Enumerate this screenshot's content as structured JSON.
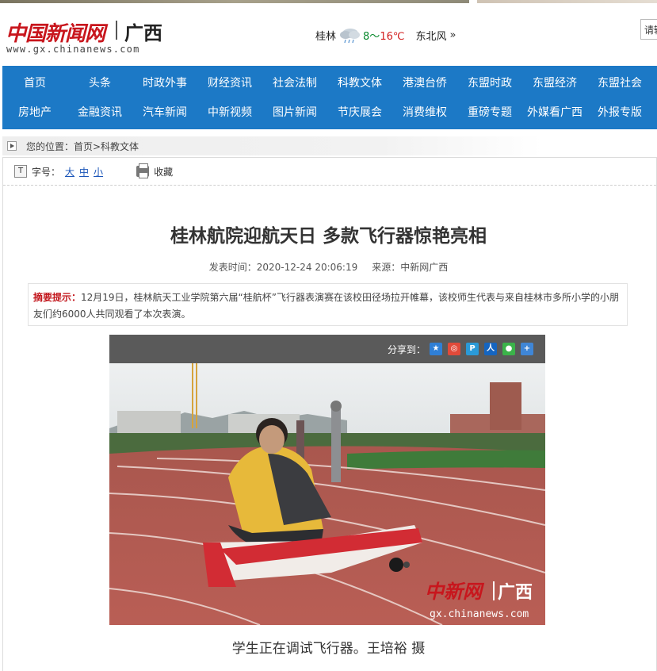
{
  "site": {
    "logo_cn": "中国新闻网",
    "region": "广西",
    "url": "www.gx.chinanews.com"
  },
  "weather": {
    "city": "桂林",
    "icon": "rain-cloud-icon",
    "temp_low": "8",
    "temp_sep": "～",
    "temp_high": "16℃",
    "wind": "东北风",
    "more": "»"
  },
  "search": {
    "label": "请输"
  },
  "nav": {
    "row1": [
      "首页",
      "头条",
      "时政外事",
      "财经资讯",
      "社会法制",
      "科教文体",
      "港澳台侨",
      "东盟时政",
      "东盟经济",
      "东盟社会"
    ],
    "row2": [
      "房地产",
      "金融资讯",
      "汽车新闻",
      "中新视频",
      "图片新闻",
      "节庆展会",
      "消费维权",
      "重磅专题",
      "外媒看广西",
      "外报专版"
    ]
  },
  "breadcrumb": {
    "text": "您的位置：首页>科教文体"
  },
  "toolbar": {
    "font_label": "字号：",
    "font_large": "大",
    "font_medium": "中",
    "font_small": "小",
    "favorite": "收藏"
  },
  "article": {
    "title": "桂林航院迎航天日 多款飞行器惊艳亮相",
    "published": "发表时间：2020-12-24 20:06:19",
    "source": "来源：中新网广西",
    "summary_label": "摘要提示：",
    "summary_text": "12月19日，桂林航天工业学院第六届“桂航杯”飞行器表演赛在该校田径场拉开帷幕，该校师生代表与来自桂林市多所小学的小朋友们约6000人共同观看了本次表演。",
    "caption": "学生正在调试飞行器。王培裕 摄"
  },
  "share": {
    "label": "分享到：",
    "icons": [
      "qzone-icon",
      "weibo-icon",
      "tencent-weibo-icon",
      "renren-icon",
      "wechat-icon",
      "more-share-icon"
    ],
    "colors": [
      "#2f7fd6",
      "#e14a3a",
      "#2a9ad8",
      "#1565c0",
      "#3bb34a",
      "#3f86d6"
    ]
  },
  "watermark": {
    "cn": "中新网",
    "region": "广西",
    "url": "gx.chinanews.com"
  },
  "colors": {
    "nav_bg": "#1c79c6",
    "brand_red": "#c8161d",
    "summary_label": "#c3191f",
    "link": "#1a55b8"
  }
}
